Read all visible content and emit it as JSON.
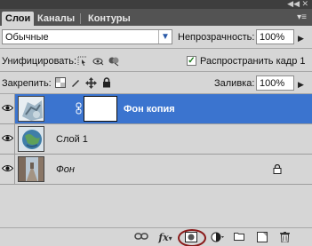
{
  "tabs": [
    {
      "label": "Слои",
      "active": true
    },
    {
      "label": "Каналы",
      "active": false
    },
    {
      "label": "Контуры",
      "active": false
    }
  ],
  "window_controls": {
    "collapse": "◀◀",
    "close": "✕"
  },
  "blend_mode": {
    "value": "Обычные"
  },
  "opacity": {
    "label": "Непрозрачность:",
    "value": "100%"
  },
  "unify": {
    "label": "Унифицировать:"
  },
  "propagate": {
    "label": "Распространить кадр 1",
    "checked": true
  },
  "lock": {
    "label": "Закрепить:"
  },
  "fill": {
    "label": "Заливка:",
    "value": "100%"
  },
  "layers": [
    {
      "name": "Фон копия",
      "selected": true,
      "has_mask": true,
      "italic": false,
      "bold": true,
      "locked": false
    },
    {
      "name": "Слой 1",
      "selected": false,
      "has_mask": false,
      "italic": false,
      "bold": false,
      "locked": false
    },
    {
      "name": "Фон",
      "selected": false,
      "has_mask": false,
      "italic": true,
      "bold": false,
      "locked": true
    }
  ],
  "bottom_toolbar": {
    "fx_label": "fx"
  },
  "colors": {
    "selection": "#3b74cf",
    "highlight_circle": "#8a1a1a",
    "tabbar": "#535353",
    "panel": "#d6d6d6"
  }
}
